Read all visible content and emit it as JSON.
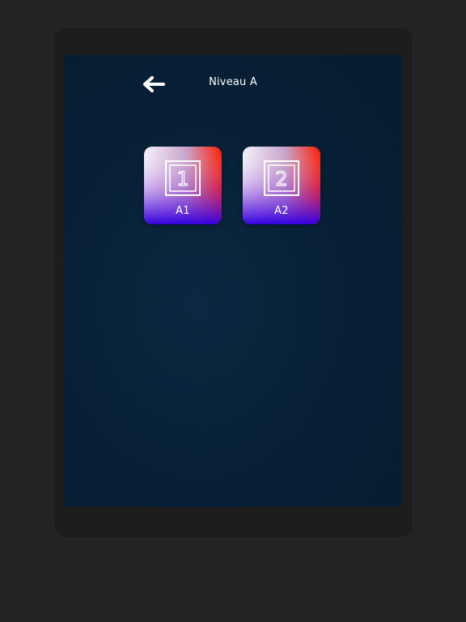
{
  "header": {
    "back_icon": "arrow-left-icon",
    "title": "Niveau A"
  },
  "levels": [
    {
      "number": "1",
      "label": "A1",
      "icon": "number-frame-icon"
    },
    {
      "number": "2",
      "label": "A2",
      "icon": "number-frame-icon"
    }
  ],
  "colors": {
    "screen_bg": "#082138",
    "tile_top_left": "#f2f2f8",
    "tile_top_right": "#ff1a00",
    "tile_bottom": "#3a00e6",
    "text": "#ffffff"
  }
}
